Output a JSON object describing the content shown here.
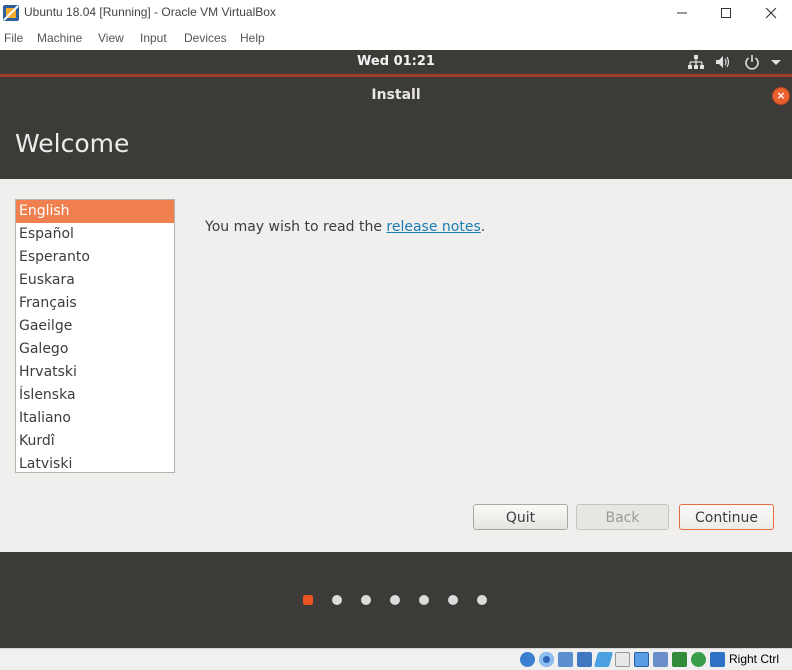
{
  "window": {
    "title": "Ubuntu 18.04 [Running] - Oracle VM VirtualBox",
    "menu": [
      "File",
      "Machine",
      "View",
      "Input",
      "Devices",
      "Help"
    ]
  },
  "panel": {
    "clock": "Wed 01:21",
    "tray_icons": [
      "network-icon",
      "volume-icon",
      "power-icon",
      "chevron-down-icon"
    ]
  },
  "installer": {
    "title": "Install",
    "heading": "Welcome",
    "languages": [
      "English",
      "Español",
      "Esperanto",
      "Euskara",
      "Français",
      "Gaeilge",
      "Galego",
      "Hrvatski",
      "Íslenska",
      "Italiano",
      "Kurdî",
      "Latviski"
    ],
    "selected_language": "English",
    "release_prefix": "You may wish to read the ",
    "release_link": "release notes",
    "release_suffix": ".",
    "buttons": {
      "quit": "Quit",
      "back": "Back",
      "continue": "Continue"
    },
    "steps": {
      "total": 7,
      "current": 1
    }
  },
  "statusbar": {
    "host_key": "Right Ctrl"
  },
  "colors": {
    "accent": "#e95420",
    "selection": "#f08050",
    "dark_panel": "#3d3b37",
    "link": "#1a7db5"
  }
}
